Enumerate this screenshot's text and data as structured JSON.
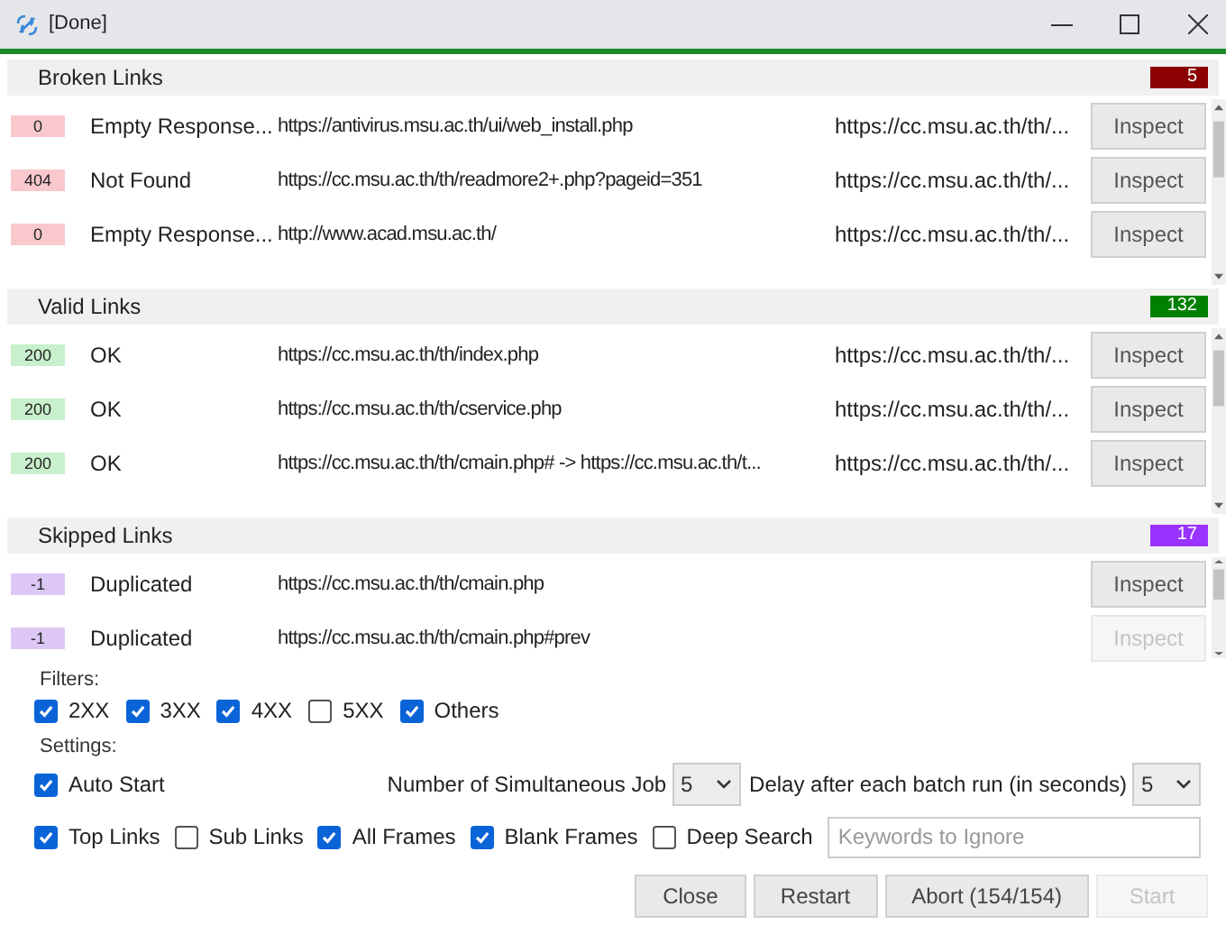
{
  "window": {
    "title": "[Done]"
  },
  "sections": [
    {
      "kind": "broken",
      "title": "Broken Links",
      "count": "5",
      "color": "#8b0000",
      "rows": [
        {
          "code": "0",
          "status": "Empty Response...",
          "url": "https://antivirus.msu.ac.th/ui/web_install.php",
          "source": "https://cc.msu.ac.th/th/...",
          "action": "Inspect",
          "disabled": false
        },
        {
          "code": "404",
          "status": "Not Found",
          "url": "https://cc.msu.ac.th/th/readmore2+.php?pageid=351",
          "source": "https://cc.msu.ac.th/th/...",
          "action": "Inspect",
          "disabled": false
        },
        {
          "code": "0",
          "status": "Empty Response...",
          "url": "http://www.acad.msu.ac.th/",
          "source": "https://cc.msu.ac.th/th/...",
          "action": "Inspect",
          "disabled": false
        }
      ]
    },
    {
      "kind": "valid",
      "title": "Valid Links",
      "count": "132",
      "color": "#008000",
      "rows": [
        {
          "code": "200",
          "status": "OK",
          "url": "https://cc.msu.ac.th/th/index.php",
          "source": "https://cc.msu.ac.th/th/...",
          "action": "Inspect",
          "disabled": false
        },
        {
          "code": "200",
          "status": "OK",
          "url": "https://cc.msu.ac.th/th/cservice.php",
          "source": "https://cc.msu.ac.th/th/...",
          "action": "Inspect",
          "disabled": false
        },
        {
          "code": "200",
          "status": "OK",
          "url": "https://cc.msu.ac.th/th/cmain.php# -> https://cc.msu.ac.th/t...",
          "source": "https://cc.msu.ac.th/th/...",
          "action": "Inspect",
          "disabled": false
        }
      ]
    },
    {
      "kind": "skipped",
      "title": "Skipped Links",
      "count": "17",
      "color": "#9933ff",
      "rows": [
        {
          "code": "-1",
          "status": "Duplicated",
          "url": "https://cc.msu.ac.th/th/cmain.php",
          "action": "Inspect",
          "disabled": false
        },
        {
          "code": "-1",
          "status": "Duplicated",
          "url": "https://cc.msu.ac.th/th/cmain.php#prev",
          "action": "Inspect",
          "disabled": true
        }
      ]
    }
  ],
  "filters": {
    "legend": "Filters:",
    "items": [
      {
        "label": "2XX",
        "checked": true
      },
      {
        "label": "3XX",
        "checked": true
      },
      {
        "label": "4XX",
        "checked": true
      },
      {
        "label": "5XX",
        "checked": false
      },
      {
        "label": "Others",
        "checked": true
      }
    ]
  },
  "settings": {
    "legend": "Settings:",
    "auto_start": {
      "label": "Auto Start",
      "checked": true
    },
    "jobs": {
      "label": "Number of Simultaneous Job",
      "value": "5"
    },
    "delay": {
      "label": "Delay after each batch run (in seconds)",
      "value": "5"
    },
    "options": [
      {
        "label": "Top Links",
        "checked": true
      },
      {
        "label": "Sub Links",
        "checked": false
      },
      {
        "label": "All Frames",
        "checked": true
      },
      {
        "label": "Blank Frames",
        "checked": true
      },
      {
        "label": "Deep Search",
        "checked": false
      }
    ],
    "keywords": {
      "placeholder": "Keywords to Ignore"
    }
  },
  "buttons": [
    {
      "label": "Close",
      "disabled": false
    },
    {
      "label": "Restart",
      "disabled": false
    },
    {
      "label": "Abort (154/154)",
      "disabled": false
    },
    {
      "label": "Start",
      "disabled": true
    }
  ]
}
